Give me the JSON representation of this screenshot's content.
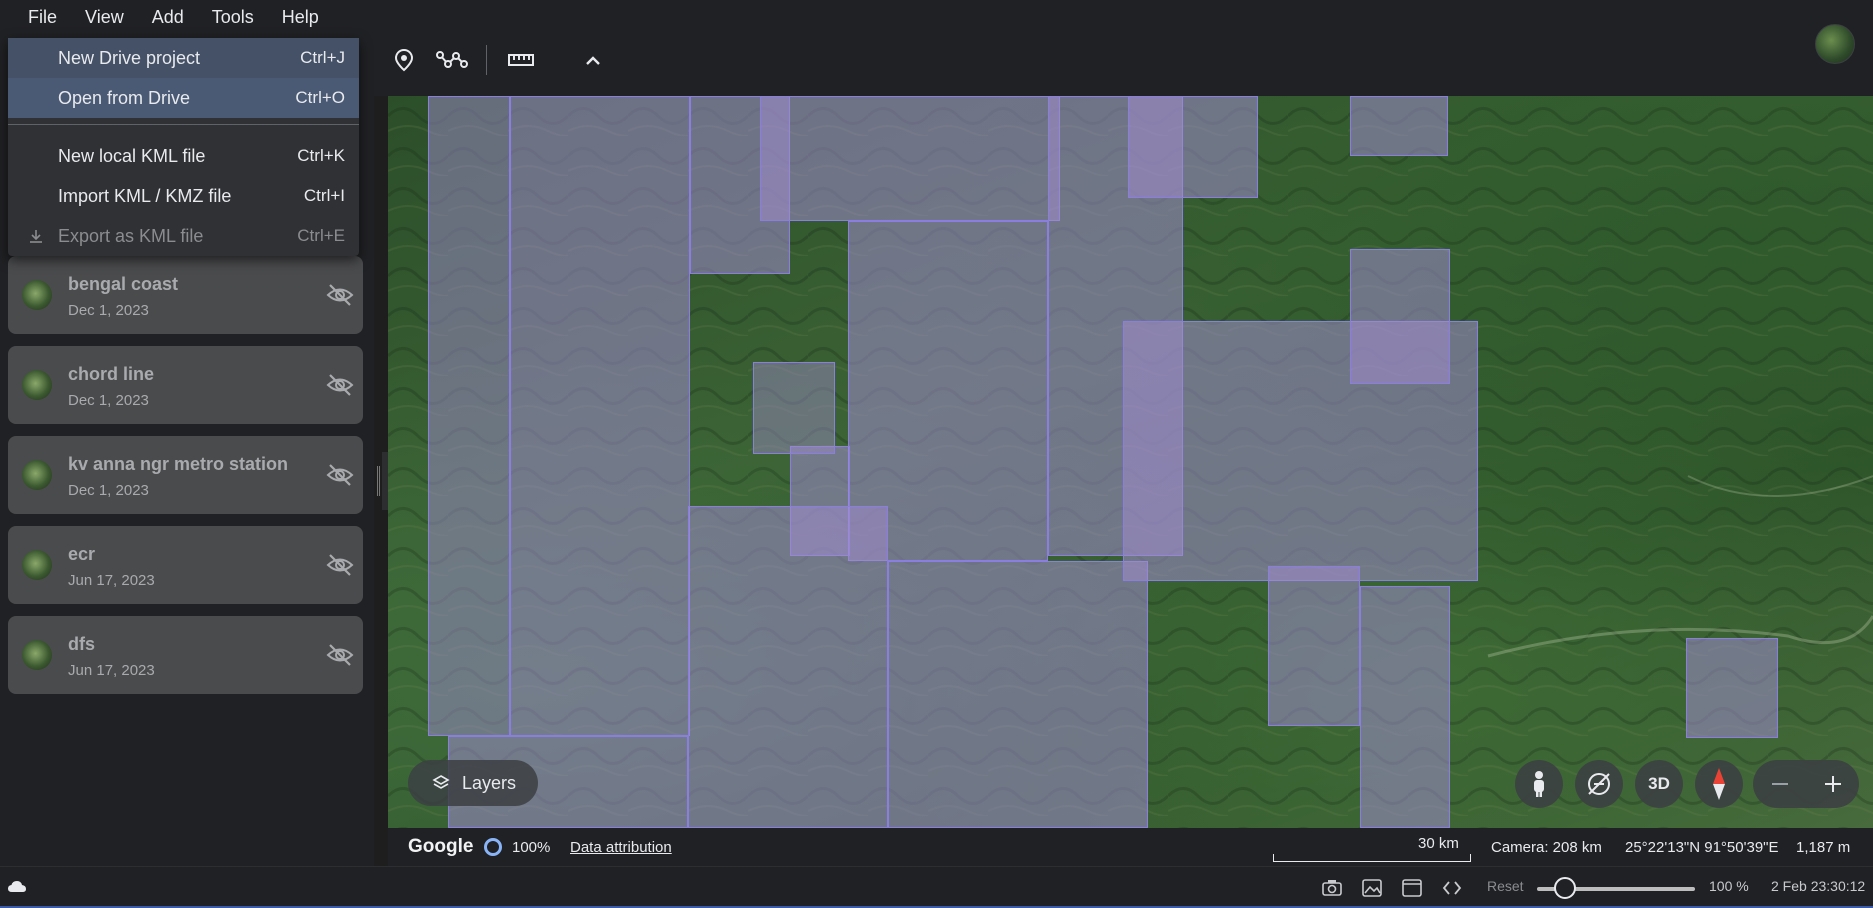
{
  "menubar": [
    "File",
    "View",
    "Add",
    "Tools",
    "Help"
  ],
  "toolbar": {
    "icons": [
      "placemark-icon",
      "path-icon",
      "ruler-icon",
      "chevron-up-icon"
    ]
  },
  "file_menu": {
    "items": [
      {
        "label": "New Drive project",
        "shortcut": "Ctrl+J",
        "state": "hover"
      },
      {
        "label": "Open from Drive",
        "shortcut": "Ctrl+O",
        "state": "selected"
      },
      {
        "label": "New local KML file",
        "shortcut": "Ctrl+K",
        "state": "normal"
      },
      {
        "label": "Import KML / KMZ file",
        "shortcut": "Ctrl+I",
        "state": "normal"
      },
      {
        "label": "Export as KML file",
        "shortcut": "Ctrl+E",
        "state": "disabled"
      }
    ]
  },
  "projects": [
    {
      "name": "bengal coast",
      "date": "Dec 1, 2023"
    },
    {
      "name": "chord line",
      "date": "Dec 1, 2023"
    },
    {
      "name": "kv anna ngr metro station",
      "date": "Dec 1, 2023"
    },
    {
      "name": "ecr",
      "date": "Jun 17, 2023"
    },
    {
      "name": "dfs",
      "date": "Jun 17, 2023"
    }
  ],
  "map": {
    "layers_label": "Layers",
    "view_mode_label": "3D",
    "footer": {
      "logo": "Google",
      "opacity": "100%",
      "attribution": "Data attribution",
      "scale": "30 km",
      "camera": "Camera: 208 km",
      "coords": "25°22'13\"N 91°50'39\"E",
      "elevation": "1,187 m"
    }
  },
  "taskbar": {
    "reset_label": "Reset",
    "zoom": "100 %",
    "zoom_slider_fraction": 0.18,
    "clock": "2 Feb 23:30:12"
  }
}
